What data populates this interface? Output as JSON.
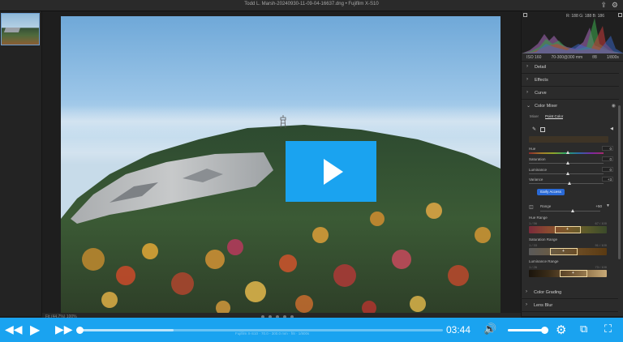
{
  "window": {
    "title": "Todd L. Marsh-20240930-11-09-04-16637.dng • Fujifilm X-S10"
  },
  "histogram": {
    "rgb_readout": "R: 188  G: 188  B: 186",
    "exif": [
      "ISO 160",
      "70-300@300 mm",
      "f/8",
      "1/800s"
    ]
  },
  "panel": {
    "sections_top": [
      {
        "label": "Detail"
      },
      {
        "label": "Effects"
      },
      {
        "label": "Curve"
      }
    ],
    "color_mixer": {
      "label": "Color Mixer",
      "tabs": [
        "Mixer",
        "Point Color"
      ],
      "active_tab": "Point Color",
      "sliders": [
        {
          "name": "Hue",
          "value": "0"
        },
        {
          "name": "Saturation",
          "value": "0"
        },
        {
          "name": "Luminance",
          "value": "0"
        },
        {
          "name": "Variance",
          "value": "+3"
        }
      ],
      "early_access": "Early Access",
      "range": {
        "label": "Range",
        "value": "+50"
      },
      "hue_range": {
        "label": "Hue Range",
        "min": "1 / 56",
        "max": "67 / 100"
      },
      "saturation_range": {
        "label": "Saturation Range",
        "min": "1 / 33",
        "max": "91 / 100"
      },
      "luminance_range": {
        "label": "Luminance Range",
        "min": "1 / 26",
        "max": "73 / 100"
      }
    },
    "sections_bottom": [
      {
        "label": "Color Grading"
      },
      {
        "label": "Lens Blur"
      }
    ]
  },
  "canvas_toolbar": {
    "zoom_text": "Fit (44.7%)   100%"
  },
  "player": {
    "time": "03:44",
    "progress_fraction": 0.0,
    "buffered_fraction": 0.26,
    "volume_fraction": 1.0,
    "faint_caption": "Fujifilm X-S10 · 70.0 - 300.0 mm · f/8 · 1/800s",
    "colors": {
      "accent": "#1aa3f0"
    }
  }
}
